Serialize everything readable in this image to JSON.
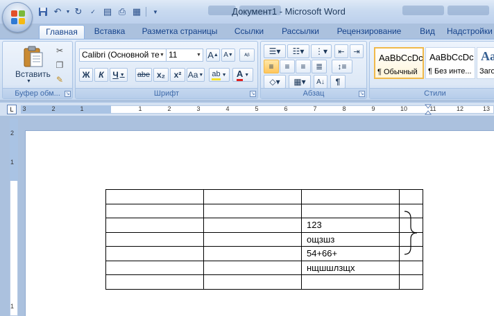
{
  "window": {
    "title": "Документ1 - Microsoft Word"
  },
  "tabs": [
    {
      "label": "Главная",
      "active": true
    },
    {
      "label": "Вставка"
    },
    {
      "label": "Разметка страницы"
    },
    {
      "label": "Ссылки"
    },
    {
      "label": "Рассылки"
    },
    {
      "label": "Рецензирование"
    },
    {
      "label": "Вид"
    },
    {
      "label": "Надстройки"
    }
  ],
  "ribbon": {
    "clipboard": {
      "label": "Буфер обм...",
      "paste_label": "Вставить"
    },
    "font": {
      "label": "Шрифт",
      "font_name": "Calibri (Основной те",
      "font_size": "11",
      "bold": "Ж",
      "italic": "К",
      "underline": "Ч",
      "strike": "abe",
      "subscript": "x₂",
      "superscript": "x²",
      "change_case": "Aa",
      "grow_font": "A",
      "shrink_font": "A",
      "font_color": "A",
      "highlight": "ab"
    },
    "paragraph": {
      "label": "Абзац",
      "pilcrow": "¶"
    },
    "styles": {
      "label": "Стили",
      "items": [
        {
          "sample": "AaBbCcDc",
          "name": "¶ Обычный",
          "active": true
        },
        {
          "sample": "AaBbCcDc",
          "name": "¶ Без инте..."
        },
        {
          "sample": "AaB",
          "name": "Заго"
        }
      ]
    }
  },
  "ruler": {
    "h_numbers": [
      "3",
      "2",
      "1",
      "1",
      "2",
      "3",
      "4",
      "5",
      "6",
      "7",
      "8",
      "9",
      "10",
      "11",
      "12",
      "13"
    ],
    "v_numbers": [
      "2",
      "1",
      "1"
    ]
  },
  "table": {
    "rows": [
      [
        "",
        "",
        "",
        ""
      ],
      [
        "",
        "",
        "",
        ""
      ],
      [
        "",
        "",
        "123",
        ""
      ],
      [
        "",
        "",
        "ощзшз",
        ""
      ],
      [
        "",
        "",
        "54+66+",
        ""
      ],
      [
        "",
        "",
        "нщшшлзщх",
        ""
      ],
      [
        "",
        "",
        "",
        ""
      ]
    ]
  }
}
